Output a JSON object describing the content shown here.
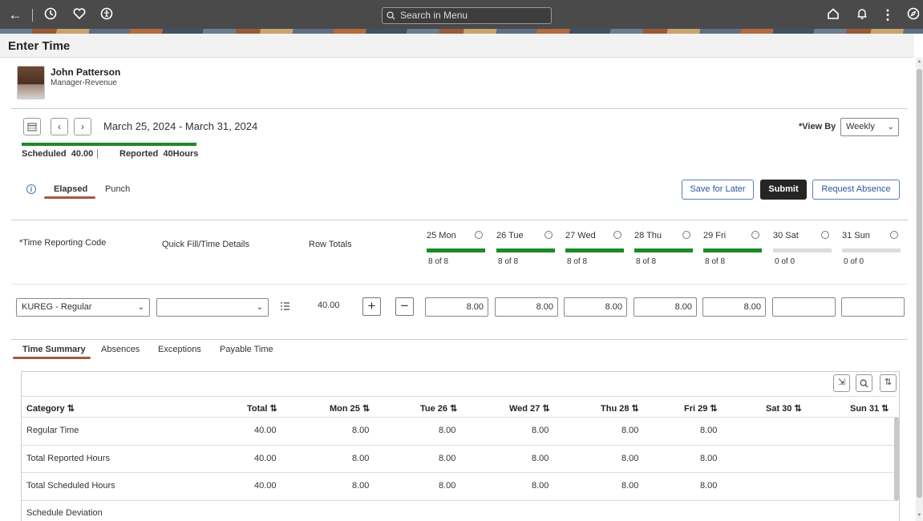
{
  "topbar": {
    "search_placeholder": "Search in Menu"
  },
  "page_title": "Enter Time",
  "employee": {
    "name": "John Patterson",
    "role": "Manager-Revenue"
  },
  "period": {
    "range": "March 25, 2024 - March 31, 2024"
  },
  "view_by": {
    "label": "*View By",
    "value": "Weekly"
  },
  "summary": {
    "scheduled": "Scheduled  40.00",
    "reported": "Reported  40Hours"
  },
  "entry_tabs": [
    {
      "label": "Elapsed"
    },
    {
      "label": "Punch"
    }
  ],
  "actions": {
    "save_later": "Save for Later",
    "submit": "Submit",
    "request_absence": "Request Absence"
  },
  "columns": {
    "trc": "*Time Reporting Code",
    "quick_fill": "Quick Fill/Time Details",
    "row_totals": "Row Totals"
  },
  "days": [
    {
      "name": "25 Mon",
      "status": "8 of 8",
      "filled": true
    },
    {
      "name": "26 Tue",
      "status": "8 of 8",
      "filled": true
    },
    {
      "name": "27 Wed",
      "status": "8 of 8",
      "filled": true
    },
    {
      "name": "28 Thu",
      "status": "8 of 8",
      "filled": true
    },
    {
      "name": "29 Fri",
      "status": "8 of 8",
      "filled": true
    },
    {
      "name": "30 Sat",
      "status": "0 of 0",
      "filled": false
    },
    {
      "name": "31 Sun",
      "status": "0 of 0",
      "filled": false
    }
  ],
  "row": {
    "trc": "KUREG - Regular",
    "quick_fill": "",
    "total": "40.00",
    "hours": [
      "8.00",
      "8.00",
      "8.00",
      "8.00",
      "8.00",
      "",
      ""
    ]
  },
  "summary_tabs": [
    {
      "label": "Time Summary"
    },
    {
      "label": "Absences"
    },
    {
      "label": "Exceptions"
    },
    {
      "label": "Payable Time"
    }
  ],
  "table": {
    "headers": [
      "Category ⇅",
      "Total ⇅",
      "Mon 25 ⇅",
      "Tue 26 ⇅",
      "Wed 27 ⇅",
      "Thu 28 ⇅",
      "Fri 29 ⇅",
      "Sat 30 ⇅",
      "Sun 31 ⇅"
    ],
    "rows": [
      {
        "category": "Regular Time",
        "total": "40.00",
        "mon": "8.00",
        "tue": "8.00",
        "wed": "8.00",
        "thu": "8.00",
        "fri": "8.00"
      },
      {
        "category": "Total Reported Hours",
        "total": "40.00",
        "mon": "8.00",
        "tue": "8.00",
        "wed": "8.00",
        "thu": "8.00",
        "fri": "8.00"
      },
      {
        "category": "Total Scheduled Hours",
        "total": "40.00",
        "mon": "8.00",
        "tue": "8.00",
        "wed": "8.00",
        "thu": "8.00",
        "fri": "8.00"
      },
      {
        "category": "Schedule Deviation",
        "total": "",
        "mon": "",
        "tue": "",
        "wed": "",
        "thu": "",
        "fri": ""
      }
    ]
  },
  "colors": {
    "accent_bar": "#1c8a2b",
    "tab_underline": "#a35a3f",
    "link": "#2b579a"
  }
}
